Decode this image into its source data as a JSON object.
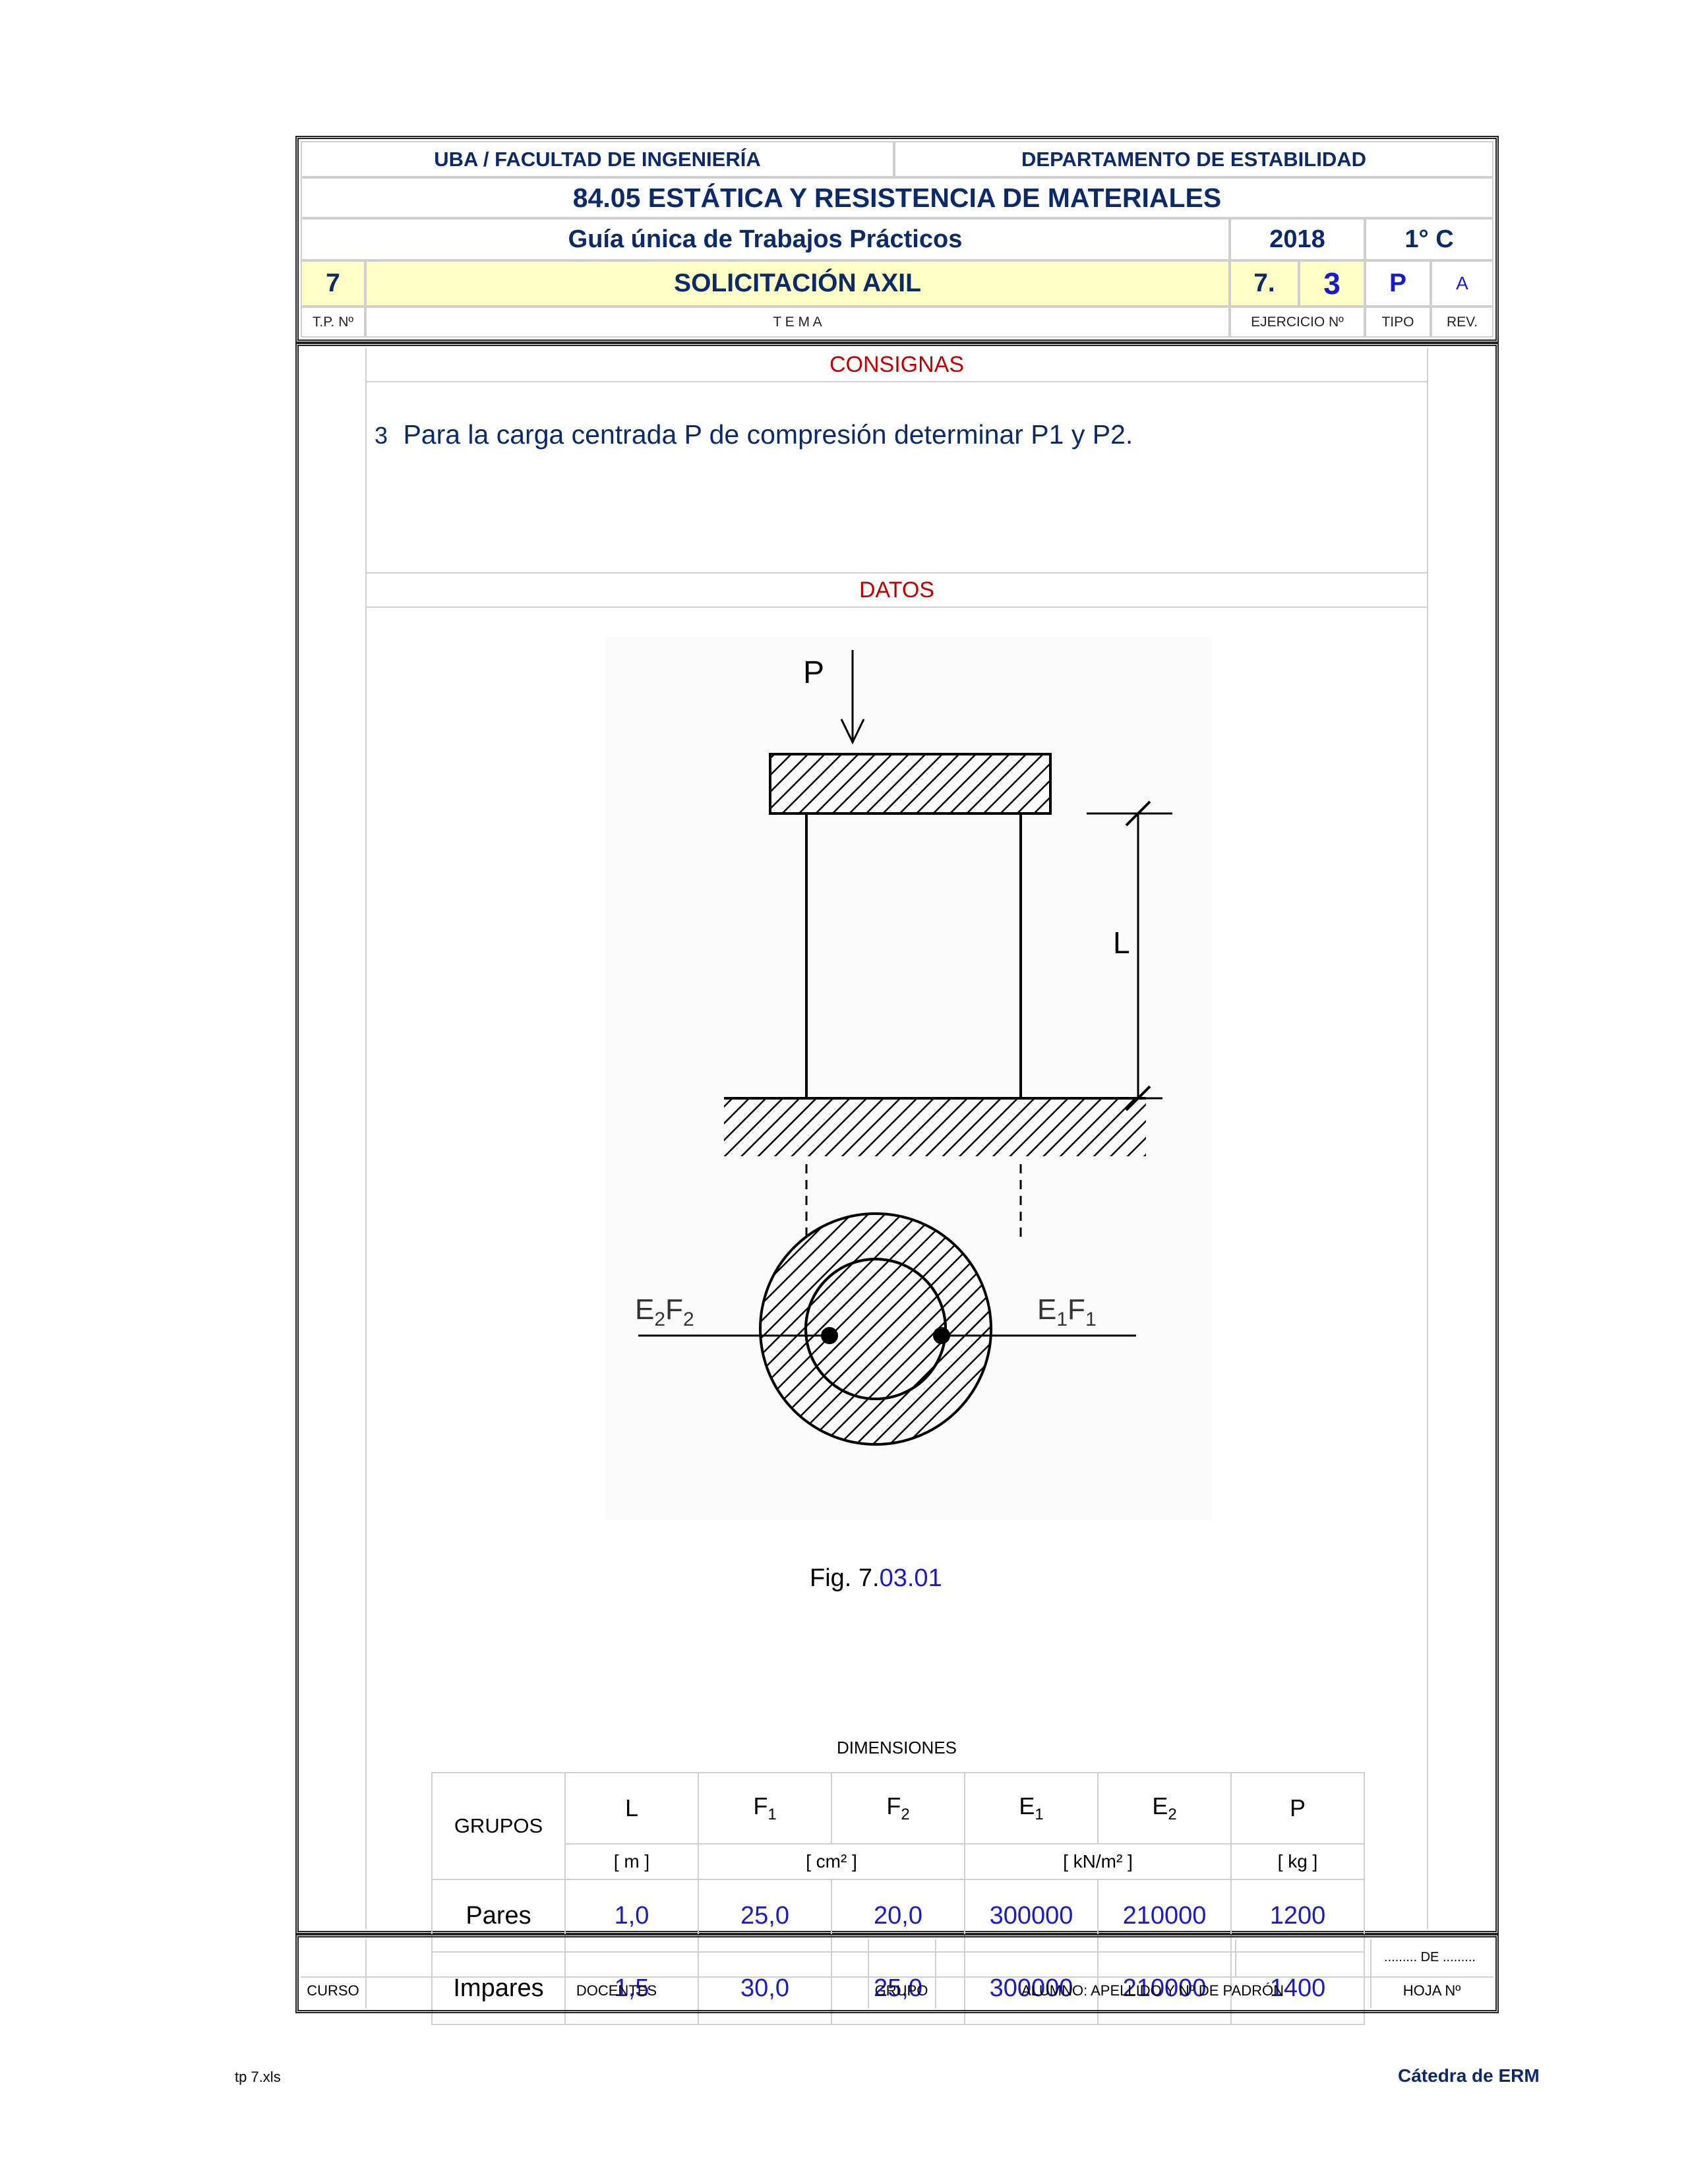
{
  "header": {
    "university": "UBA / FACULTAD DE INGENIERÍA",
    "department": "DEPARTAMENTO DE ESTABILIDAD",
    "course": "84.05 ESTÁTICA Y RESISTENCIA DE MATERIALES",
    "guide": "Guía única de Trabajos Prácticos",
    "year": "2018",
    "term": "1° C",
    "tp_number": "7",
    "topic": "SOLICITACIÓN AXIL",
    "exercise_prefix": "7.",
    "exercise_number": "3",
    "type": "P",
    "revision": "A",
    "labels": {
      "tp": "T.P. Nº",
      "topic": "T E M A",
      "exercise": "EJERCICIO Nº",
      "type": "TIPO",
      "revision": "REV."
    }
  },
  "consignas": {
    "title": "CONSIGNAS",
    "number": "3",
    "text": "Para la carga centrada P de compresión determinar P1 y P2."
  },
  "datos": {
    "title": "DATOS"
  },
  "figure": {
    "load_label": "P",
    "length_label": "L",
    "left_material": "E2F2",
    "right_material": "E1F1",
    "caption_prefix": "Fig. 7.",
    "caption_number": "03.01"
  },
  "table": {
    "title": "DIMENSIONES",
    "group_header": "GRUPOS",
    "columns": [
      "L",
      "F1",
      "F2",
      "E1",
      "E2",
      "P"
    ],
    "units": {
      "L": "[ m ]",
      "F": "[ cm² ]",
      "E": "[ kN/m² ]",
      "P": "[ kg ]"
    },
    "rows": [
      {
        "group": "Pares",
        "values": [
          "1,0",
          "25,0",
          "20,0",
          "300000",
          "210000",
          "1200"
        ]
      },
      {
        "group": "Impares",
        "values": [
          "1,5",
          "30,0",
          "25,0",
          "300000",
          "210000",
          "1400"
        ]
      }
    ]
  },
  "footer": {
    "curso": "CURSO",
    "docentes": "DOCENTES",
    "grupo": "GRUPO",
    "alumno": "ALUMNO: APELLIDO Y Nº DE PADRÓN",
    "hoja": "HOJA Nº",
    "de": "......... DE ........."
  },
  "page_footer": {
    "file": "tp 7.xls",
    "chair": "Cátedra de ERM"
  }
}
